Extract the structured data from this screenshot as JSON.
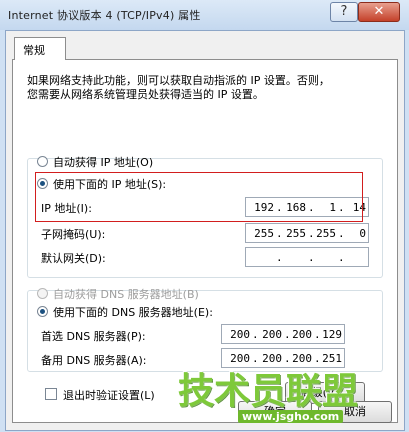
{
  "window": {
    "title": "Internet 协议版本 4 (TCP/IPv4) 属性",
    "help_label": "?",
    "close_label": "✕"
  },
  "tab": {
    "label": "常规"
  },
  "description": [
    "如果网络支持此功能，则可以获取自动指派的 IP 设置。否则，",
    "您需要从网络系统管理员处获得适当的 IP 设置。"
  ],
  "ip_section": {
    "auto_label": "自动获得 IP 地址(O)",
    "auto_selected": false,
    "manual_label": "使用下面的 IP 地址(S):",
    "manual_selected": true,
    "fields": [
      {
        "label": "IP 地址(I):",
        "octets": [
          "192",
          "168",
          "1",
          "14"
        ]
      },
      {
        "label": "子网掩码(U):",
        "octets": [
          "255",
          "255",
          "255",
          "0"
        ]
      },
      {
        "label": "默认网关(D):",
        "octets": [
          "",
          "",
          "",
          ""
        ]
      }
    ]
  },
  "dns_section": {
    "auto_label": "自动获得 DNS 服务器地址(B)",
    "auto_selected": false,
    "manual_label": "使用下面的 DNS 服务器地址(E):",
    "manual_selected": true,
    "fields": [
      {
        "label": "首选 DNS 服务器(P):",
        "octets": [
          "200",
          "200",
          "200",
          "129"
        ]
      },
      {
        "label": "备用 DNS 服务器(A):",
        "octets": [
          "200",
          "200",
          "200",
          "251"
        ]
      }
    ]
  },
  "validate_on_exit": {
    "label": "退出时验证设置(L)",
    "checked": false
  },
  "buttons": {
    "advanced": "高级(V)...",
    "ok": "确定",
    "cancel": "取消"
  },
  "watermark": {
    "main": "技术员联盟",
    "url": "www.jsgho.com"
  },
  "colors": {
    "highlight": "#d21e1e",
    "watermark": "#7ec93a",
    "radio_dot": "#1c5180"
  }
}
